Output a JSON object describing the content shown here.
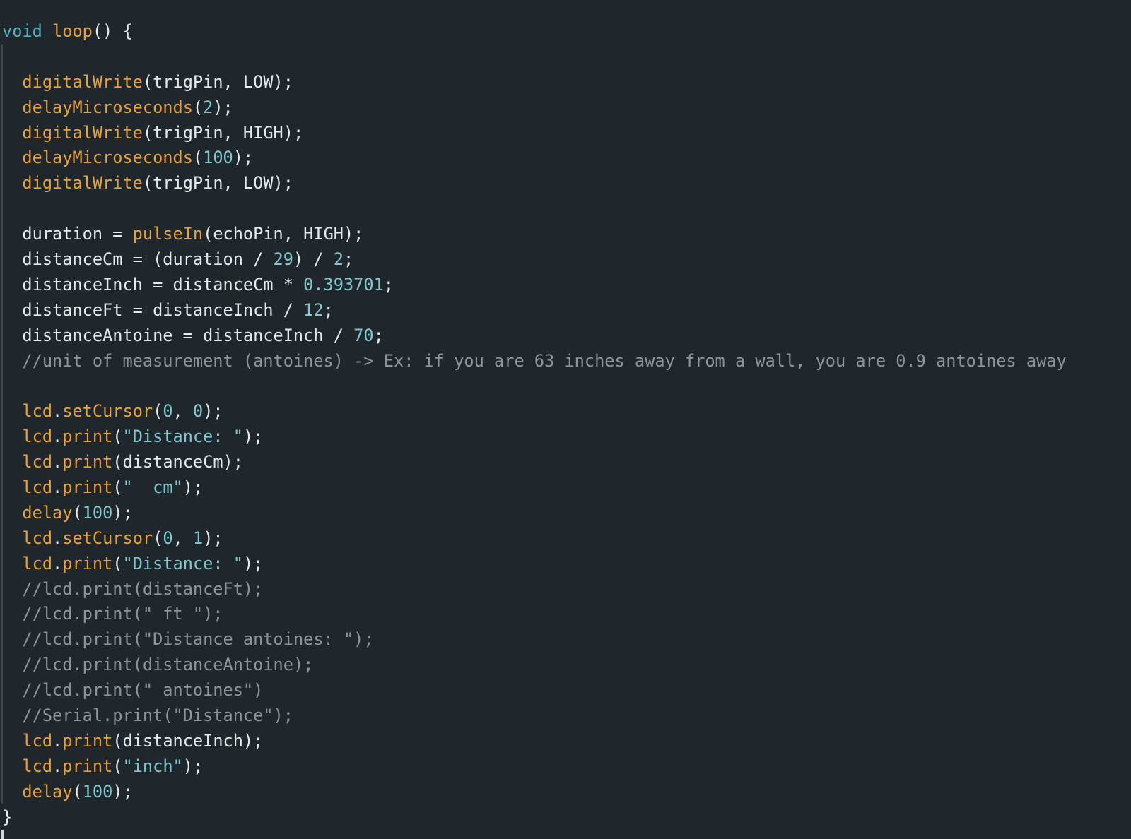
{
  "editor": {
    "theme": {
      "background": "#1f272c",
      "keyword": "#4fb4b9",
      "function": "#e8a23c",
      "number": "#7fc8cf",
      "string": "#7fc8cf",
      "comment": "#8b959c",
      "text": "#e6eaed"
    },
    "lines": [
      [
        {
          "t": "kw",
          "v": "void"
        },
        {
          "t": "pl",
          "v": " "
        },
        {
          "t": "fn",
          "v": "loop"
        },
        {
          "t": "pl",
          "v": "() {"
        }
      ],
      [],
      [
        {
          "t": "pl",
          "v": "  "
        },
        {
          "t": "fn",
          "v": "digitalWrite"
        },
        {
          "t": "pl",
          "v": "(trigPin, LOW);"
        }
      ],
      [
        {
          "t": "pl",
          "v": "  "
        },
        {
          "t": "fn",
          "v": "delayMicroseconds"
        },
        {
          "t": "pl",
          "v": "("
        },
        {
          "t": "num",
          "v": "2"
        },
        {
          "t": "pl",
          "v": ");"
        }
      ],
      [
        {
          "t": "pl",
          "v": "  "
        },
        {
          "t": "fn",
          "v": "digitalWrite"
        },
        {
          "t": "pl",
          "v": "(trigPin, HIGH);"
        }
      ],
      [
        {
          "t": "pl",
          "v": "  "
        },
        {
          "t": "fn",
          "v": "delayMicroseconds"
        },
        {
          "t": "pl",
          "v": "("
        },
        {
          "t": "num",
          "v": "100"
        },
        {
          "t": "pl",
          "v": ");"
        }
      ],
      [
        {
          "t": "pl",
          "v": "  "
        },
        {
          "t": "fn",
          "v": "digitalWrite"
        },
        {
          "t": "pl",
          "v": "(trigPin, LOW);"
        }
      ],
      [],
      [
        {
          "t": "pl",
          "v": "  duration = "
        },
        {
          "t": "fn",
          "v": "pulseIn"
        },
        {
          "t": "pl",
          "v": "(echoPin, HIGH);"
        }
      ],
      [
        {
          "t": "pl",
          "v": "  distanceCm = (duration / "
        },
        {
          "t": "num",
          "v": "29"
        },
        {
          "t": "pl",
          "v": ") / "
        },
        {
          "t": "num",
          "v": "2"
        },
        {
          "t": "pl",
          "v": ";"
        }
      ],
      [
        {
          "t": "pl",
          "v": "  distanceInch = distanceCm * "
        },
        {
          "t": "num",
          "v": "0.393701"
        },
        {
          "t": "pl",
          "v": ";"
        }
      ],
      [
        {
          "t": "pl",
          "v": "  distanceFt = distanceInch / "
        },
        {
          "t": "num",
          "v": "12"
        },
        {
          "t": "pl",
          "v": ";"
        }
      ],
      [
        {
          "t": "pl",
          "v": "  distanceAntoine = distanceInch / "
        },
        {
          "t": "num",
          "v": "70"
        },
        {
          "t": "pl",
          "v": ";"
        }
      ],
      [
        {
          "t": "pl",
          "v": "  "
        },
        {
          "t": "cm",
          "v": "//unit of measurement (antoines) -> Ex: if you are 63 inches away from a wall, you are 0.9 antoines away"
        }
      ],
      [],
      [
        {
          "t": "pl",
          "v": "  "
        },
        {
          "t": "fn",
          "v": "lcd"
        },
        {
          "t": "pl",
          "v": "."
        },
        {
          "t": "fn",
          "v": "setCursor"
        },
        {
          "t": "pl",
          "v": "("
        },
        {
          "t": "num",
          "v": "0"
        },
        {
          "t": "pl",
          "v": ", "
        },
        {
          "t": "num",
          "v": "0"
        },
        {
          "t": "pl",
          "v": ");"
        }
      ],
      [
        {
          "t": "pl",
          "v": "  "
        },
        {
          "t": "fn",
          "v": "lcd"
        },
        {
          "t": "pl",
          "v": "."
        },
        {
          "t": "fn",
          "v": "print"
        },
        {
          "t": "pl",
          "v": "("
        },
        {
          "t": "str",
          "v": "\"Distance: \""
        },
        {
          "t": "pl",
          "v": ");"
        }
      ],
      [
        {
          "t": "pl",
          "v": "  "
        },
        {
          "t": "fn",
          "v": "lcd"
        },
        {
          "t": "pl",
          "v": "."
        },
        {
          "t": "fn",
          "v": "print"
        },
        {
          "t": "pl",
          "v": "(distanceCm);"
        }
      ],
      [
        {
          "t": "pl",
          "v": "  "
        },
        {
          "t": "fn",
          "v": "lcd"
        },
        {
          "t": "pl",
          "v": "."
        },
        {
          "t": "fn",
          "v": "print"
        },
        {
          "t": "pl",
          "v": "("
        },
        {
          "t": "str",
          "v": "\"  cm\""
        },
        {
          "t": "pl",
          "v": ");"
        }
      ],
      [
        {
          "t": "pl",
          "v": "  "
        },
        {
          "t": "fn",
          "v": "delay"
        },
        {
          "t": "pl",
          "v": "("
        },
        {
          "t": "num",
          "v": "100"
        },
        {
          "t": "pl",
          "v": ");"
        }
      ],
      [
        {
          "t": "pl",
          "v": "  "
        },
        {
          "t": "fn",
          "v": "lcd"
        },
        {
          "t": "pl",
          "v": "."
        },
        {
          "t": "fn",
          "v": "setCursor"
        },
        {
          "t": "pl",
          "v": "("
        },
        {
          "t": "num",
          "v": "0"
        },
        {
          "t": "pl",
          "v": ", "
        },
        {
          "t": "num",
          "v": "1"
        },
        {
          "t": "pl",
          "v": ");"
        }
      ],
      [
        {
          "t": "pl",
          "v": "  "
        },
        {
          "t": "fn",
          "v": "lcd"
        },
        {
          "t": "pl",
          "v": "."
        },
        {
          "t": "fn",
          "v": "print"
        },
        {
          "t": "pl",
          "v": "("
        },
        {
          "t": "str",
          "v": "\"Distance: \""
        },
        {
          "t": "pl",
          "v": ");"
        }
      ],
      [
        {
          "t": "pl",
          "v": "  "
        },
        {
          "t": "cm",
          "v": "//lcd.print(distanceFt);"
        }
      ],
      [
        {
          "t": "pl",
          "v": "  "
        },
        {
          "t": "cm",
          "v": "//lcd.print(\" ft \");"
        }
      ],
      [
        {
          "t": "pl",
          "v": "  "
        },
        {
          "t": "cm",
          "v": "//lcd.print(\"Distance antoines: \");"
        }
      ],
      [
        {
          "t": "pl",
          "v": "  "
        },
        {
          "t": "cm",
          "v": "//lcd.print(distanceAntoine);"
        }
      ],
      [
        {
          "t": "pl",
          "v": "  "
        },
        {
          "t": "cm",
          "v": "//lcd.print(\" antoines\")"
        }
      ],
      [
        {
          "t": "pl",
          "v": "  "
        },
        {
          "t": "cm",
          "v": "//Serial.print(\"Distance\");"
        }
      ],
      [
        {
          "t": "pl",
          "v": "  "
        },
        {
          "t": "fn",
          "v": "lcd"
        },
        {
          "t": "pl",
          "v": "."
        },
        {
          "t": "fn",
          "v": "print"
        },
        {
          "t": "pl",
          "v": "(distanceInch);"
        }
      ],
      [
        {
          "t": "pl",
          "v": "  "
        },
        {
          "t": "fn",
          "v": "lcd"
        },
        {
          "t": "pl",
          "v": "."
        },
        {
          "t": "fn",
          "v": "print"
        },
        {
          "t": "pl",
          "v": "("
        },
        {
          "t": "str",
          "v": "\"inch\""
        },
        {
          "t": "pl",
          "v": ");"
        }
      ],
      [
        {
          "t": "pl",
          "v": "  "
        },
        {
          "t": "fn",
          "v": "delay"
        },
        {
          "t": "pl",
          "v": "("
        },
        {
          "t": "num",
          "v": "100"
        },
        {
          "t": "pl",
          "v": ");"
        }
      ],
      [
        {
          "t": "pl",
          "v": "}"
        }
      ]
    ]
  }
}
